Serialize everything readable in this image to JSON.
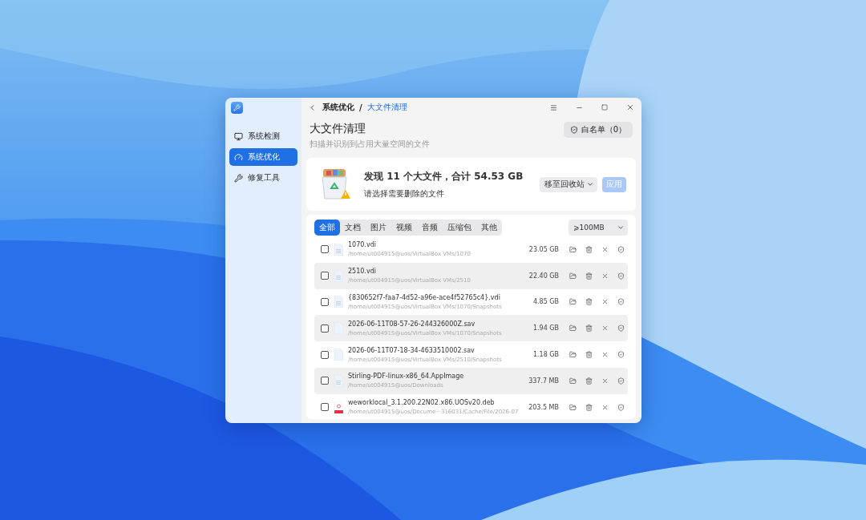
{
  "window": {
    "breadcrumb_parent": "系统优化",
    "breadcrumb_separator": "/",
    "breadcrumb_current": "大文件清理"
  },
  "sidebar": {
    "items": [
      {
        "label": "系统检测",
        "selected": false
      },
      {
        "label": "系统优化",
        "selected": true
      },
      {
        "label": "修复工具",
        "selected": false
      }
    ]
  },
  "page": {
    "title": "大文件清理",
    "subtitle": "扫描并识别到占用大量空间的文件",
    "whitelist_button": "白名单（0）"
  },
  "summary": {
    "headline": "发现 11 个大文件，合计 54.53 GB",
    "hint": "请选择需要删除的文件",
    "action_select": "移至回收站",
    "apply_button": {
      "label": "应用",
      "disabled": true
    }
  },
  "filter_tabs": [
    {
      "label": "全部",
      "selected": true
    },
    {
      "label": "文档",
      "selected": false
    },
    {
      "label": "图片",
      "selected": false
    },
    {
      "label": "视频",
      "selected": false
    },
    {
      "label": "音频",
      "selected": false
    },
    {
      "label": "压缩包",
      "selected": false
    },
    {
      "label": "其他",
      "selected": false
    }
  ],
  "size_filter": "⩾100MB",
  "files": [
    {
      "name": "1070.vdi",
      "path": "/home/ut004915@uos/VirtualBox VMs/1070",
      "size": "23.05 GB",
      "checked": false,
      "kind": "lined"
    },
    {
      "name": "2510.vdi",
      "path": "/home/ut004915@uos/VirtualBox VMs/2510",
      "size": "22.40 GB",
      "checked": false,
      "kind": "lined"
    },
    {
      "name": "{830652f7-faa7-4d52-a96e-ace4f52765c4}.vdi",
      "path": "/home/ut004915@uos/VirtualBox VMs/1070/Snapshots",
      "size": "4.85 GB",
      "checked": false,
      "kind": "lined"
    },
    {
      "name": "2026-06-11T08-57-26-244326000Z.sav",
      "path": "/home/ut004915@uos/VirtualBox VMs/1070/Snapshots",
      "size": "1.94 GB",
      "checked": false,
      "kind": "blank"
    },
    {
      "name": "2026-06-11T07-18-34-4633510002.sav",
      "path": "/home/ut004915@uos/VirtualBox VMs/2510/Snapshots",
      "size": "1.18 GB",
      "checked": false,
      "kind": "blank"
    },
    {
      "name": "Stirling-PDF-linux-x86_64.AppImage",
      "path": "/home/ut004915@uos/Downloads",
      "size": "337.7 MB",
      "checked": false,
      "kind": "lined"
    },
    {
      "name": "weworklocal_3.1.200.22N02.x86.UOSv20.deb",
      "path": "/home/ut004915@uos/Docume···316031/Cache/File/2026-07",
      "size": "203.5 MB",
      "checked": false,
      "kind": "package"
    }
  ]
}
